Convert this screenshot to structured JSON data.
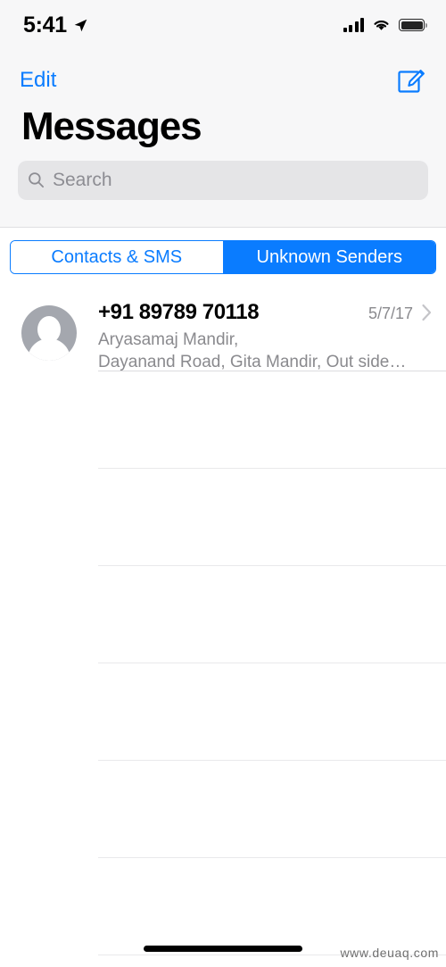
{
  "status_bar": {
    "time": "5:41",
    "location_icon": "location-arrow-icon",
    "signal_icon": "cellular-signal-icon",
    "signal_bars": 4,
    "wifi_icon": "wifi-icon",
    "battery_icon": "battery-full-icon",
    "battery_level": 100
  },
  "header": {
    "edit_label": "Edit",
    "compose_icon": "compose-pencil-icon",
    "title": "Messages"
  },
  "search": {
    "placeholder": "Search",
    "value": "",
    "icon": "search-magnifier-icon"
  },
  "segmented_control": {
    "selected_index": 1,
    "options": [
      {
        "label": "Contacts & SMS",
        "selected": false
      },
      {
        "label": "Unknown Senders",
        "selected": true
      }
    ]
  },
  "conversations": [
    {
      "avatar_icon": "person-placeholder-avatar",
      "title": "+91 89789 70118",
      "date": "5/7/17",
      "chevron_icon": "chevron-right-icon",
      "preview_line1": "Aryasamaj Mandir,",
      "preview_line2": "Dayanand Road, Gita Mandir, Out side…"
    }
  ],
  "empty_rows": 6,
  "footer": {
    "home_indicator": "home-indicator-bar",
    "watermark": "www.deuaq.com"
  },
  "colors": {
    "accent_blue": "#0a7cff",
    "header_background": "#f7f7f8",
    "search_background": "#e5e5e7",
    "secondary_text": "#8a8a8e",
    "separator": "#dcdcdf",
    "avatar_gray": "#a4a7ae"
  }
}
